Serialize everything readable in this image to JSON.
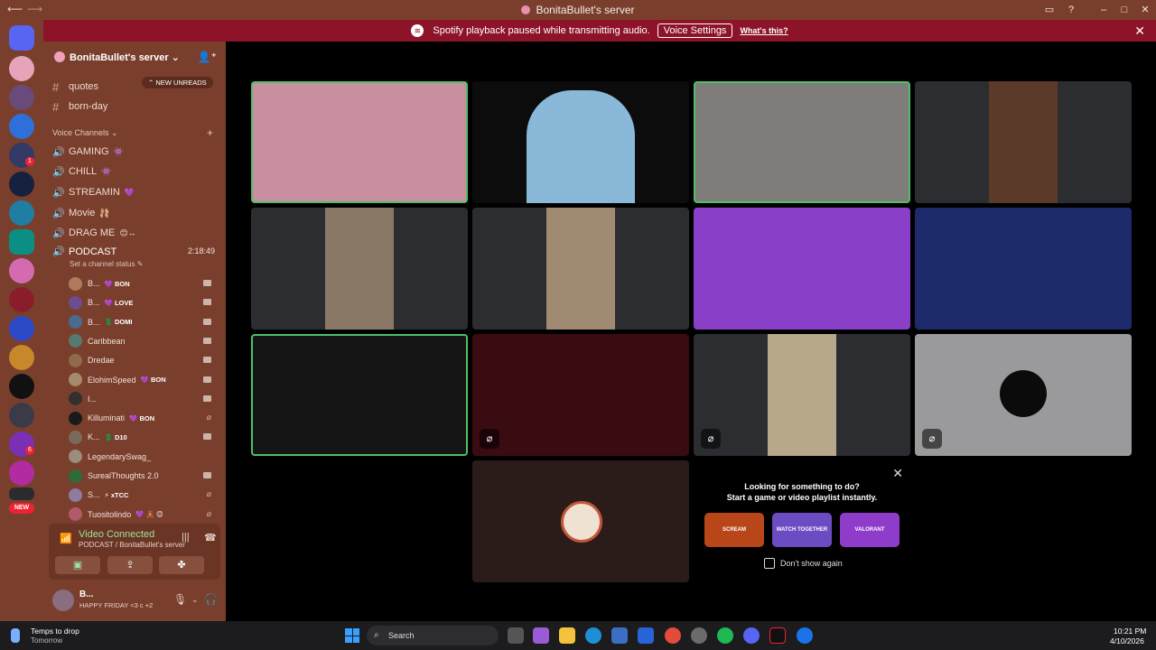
{
  "window": {
    "title": "BonitaBullet's server"
  },
  "notice": {
    "text": "Spotify playback paused while transmitting audio.",
    "button": "Voice Settings",
    "link": "What's this?"
  },
  "server": {
    "name": "BonitaBullet's server"
  },
  "channels": {
    "text": [
      {
        "name": "quotes"
      },
      {
        "name": "born-day"
      }
    ],
    "new_unreads": "NEW UNREADS",
    "voice_header": "Voice Channels",
    "voice": [
      {
        "name": "GAMING",
        "emoji": "👾"
      },
      {
        "name": "CHILL",
        "emoji": "👾"
      },
      {
        "name": "STREAMIN",
        "emoji": "💜"
      },
      {
        "name": "Movie",
        "emoji": "🩰"
      },
      {
        "name": "DRAG ME",
        "emoji": "😊↔"
      }
    ],
    "active": {
      "name": "PODCAST",
      "time": "2:18:49",
      "status_placeholder": "Set a channel status"
    }
  },
  "members": [
    {
      "name": "B...",
      "tag": "💜 BON",
      "icon": "camera-icon",
      "color": "#b07a5f"
    },
    {
      "name": "B...",
      "tag": "💜 LOVE",
      "icon": "camera-icon",
      "color": "#6d4c8f"
    },
    {
      "name": "B...",
      "tag": "💲 DOMI",
      "icon": "camera-icon",
      "color": "#4a6b8f"
    },
    {
      "name": "Caribbean",
      "tag": "",
      "icon": "camera-icon",
      "color": "#557a6f"
    },
    {
      "name": "Dredae",
      "tag": "",
      "icon": "camera-icon",
      "color": "#8f6a4c"
    },
    {
      "name": "ElohimSpeed",
      "tag": "💜 BON",
      "icon": "camera-icon",
      "color": "#a58b6a"
    },
    {
      "name": "I...",
      "tag": "",
      "icon": "camera-icon",
      "color": "#30302f"
    },
    {
      "name": "Killuminati",
      "tag": "💜 BON",
      "icon": "muted-camera-icon",
      "color": "#1a1a1a"
    },
    {
      "name": "K...",
      "tag": "💲 D10",
      "icon": "camera-icon",
      "color": "#7a6a5c"
    },
    {
      "name": "LegendarySwag_",
      "tag": "",
      "icon": "",
      "color": "#9b8c7e"
    },
    {
      "name": "SurealThoughts 2.0",
      "tag": "",
      "icon": "camera-icon",
      "color": "#2f6a39"
    },
    {
      "name": "S...",
      "tag": "⚡ xTCC",
      "icon": "muted-camera-icon",
      "color": "#8d7ba0"
    },
    {
      "name": "Tuositolindo",
      "tag": "💜 🧸 😊",
      "icon": "muted-camera-icon",
      "color": "#b05a6a"
    }
  ],
  "voice_panel": {
    "title": "Video Connected",
    "subtitle": "PODCAST / BonitaBullet's server"
  },
  "user": {
    "name": "B...",
    "status": "HAPPY FRIDAY <3 c +2"
  },
  "suggest": {
    "line1": "Looking for something to do?",
    "line2": "Start a game or video playlist instantly.",
    "checkbox": "Don't show again",
    "games": [
      {
        "label": "SCREAM",
        "color": "#b84618"
      },
      {
        "label": "WATCH TOGETHER",
        "color": "#6b4cc2"
      },
      {
        "label": "VALORANT",
        "color": "#8e3cc9"
      }
    ]
  },
  "taskbar": {
    "weather1": "Temps to drop",
    "weather2": "Tomorrow",
    "search_placeholder": "Search",
    "time": "10:21 PM",
    "date": "4/10/2026"
  },
  "rail": {
    "new_label": "NEW"
  }
}
